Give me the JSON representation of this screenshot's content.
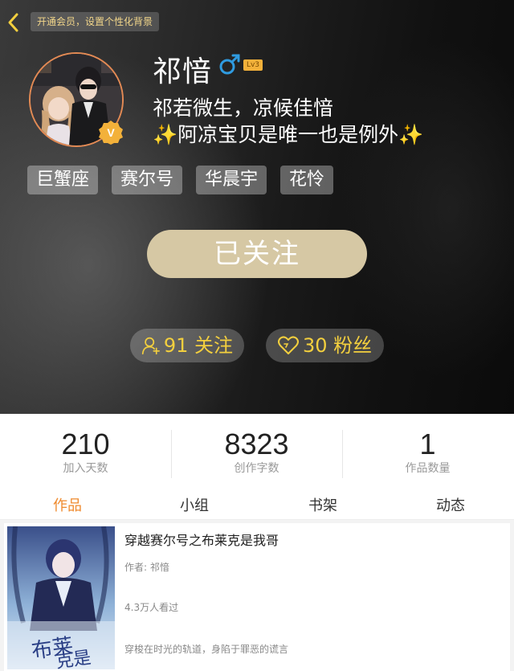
{
  "header": {
    "vip_banner": "开通会员，设置个性化背景",
    "username": "祁愔",
    "level": "Lv3",
    "bio_line1": "祁若微生，凉候佳愔",
    "bio_line2_sparkle_left": "✨",
    "bio_line2_text": "阿凉宝贝是唯一也是例外",
    "bio_line2_sparkle_right": "✨",
    "tags": [
      "巨蟹座",
      "赛尔号",
      "华晨宇",
      "花怜"
    ],
    "follow_button": "已关注",
    "following_label": "91 关注",
    "fans_label": "30 粉丝"
  },
  "stats": [
    {
      "value": "210",
      "label": "加入天数"
    },
    {
      "value": "8323",
      "label": "创作字数"
    },
    {
      "value": "1",
      "label": "作品数量"
    }
  ],
  "tabs": [
    {
      "label": "作品",
      "active": true
    },
    {
      "label": "小组",
      "active": false
    },
    {
      "label": "书架",
      "active": false
    },
    {
      "label": "动态",
      "active": false
    }
  ],
  "book": {
    "title": "穿越赛尔号之布莱克是我哥",
    "author": "作者: 祁愔",
    "reads": "4.3万人看过",
    "description": "穿梭在时光的轨道，身陷于罪恶的谎言"
  },
  "colors": {
    "accent_tab": "#ef8a2e",
    "pill_text": "#f3cf3e",
    "follow_button_bg": "#d6c8a4",
    "avatar_border": "#e38a54",
    "vip_badge": "#f3b13a"
  },
  "icons": {
    "back": "chevron-left-icon",
    "gender": "male-icon",
    "vip": "vip-badge-icon",
    "following": "person-add-icon",
    "fans": "heart-icon"
  }
}
